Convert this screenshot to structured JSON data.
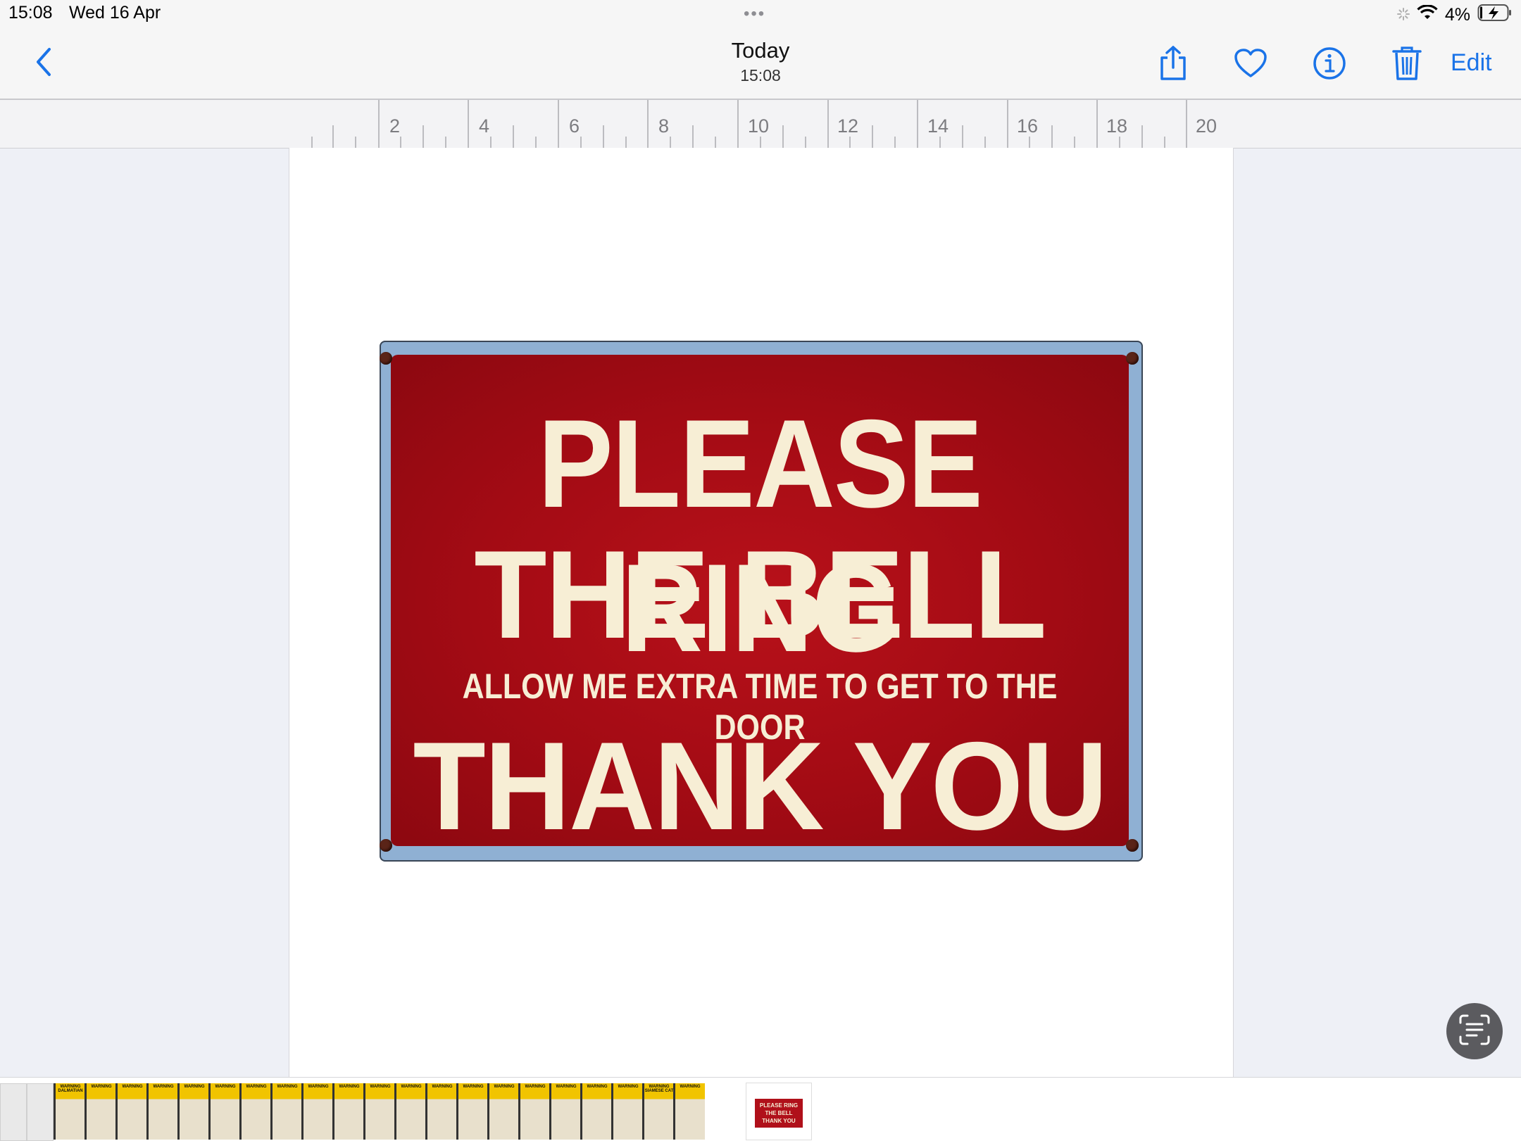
{
  "status_bar": {
    "time": "15:08",
    "date": "Wed 16 Apr",
    "battery": "4%",
    "more_indicator": "•••",
    "icons": [
      "activity-spinner-icon",
      "wifi-icon",
      "battery-charging-icon"
    ]
  },
  "nav": {
    "title": "Today",
    "subtitle": "15:08",
    "edit_label": "Edit",
    "accent": "#1a73e8",
    "icons": [
      "back-chevron-icon",
      "share-icon",
      "favorite-heart-icon",
      "info-icon",
      "trash-icon"
    ]
  },
  "ruler": {
    "labels": [
      "2",
      "4",
      "6",
      "8",
      "10",
      "12",
      "14",
      "16",
      "18",
      "20"
    ]
  },
  "document": {
    "sign": {
      "line1": "PLEASE RING",
      "line2": "THE BELL",
      "line3": "ALLOW ME EXTRA TIME TO GET TO THE DOOR",
      "line4": "THANK YOU",
      "colors": {
        "background": "#a30b14",
        "text": "#f7eed5",
        "frame": "#8fb0d3"
      }
    }
  },
  "live_text_button": {
    "icon": "live-text-icon"
  },
  "filmstrip": {
    "thumbnails": [
      {
        "kind": "document",
        "label": ""
      },
      {
        "kind": "document",
        "label": ""
      },
      {
        "kind": "warning",
        "label": "WARNING DALMATIAN"
      },
      {
        "kind": "warning",
        "label": "WARNING"
      },
      {
        "kind": "warning",
        "label": "WARNING"
      },
      {
        "kind": "warning",
        "label": "WARNING"
      },
      {
        "kind": "warning",
        "label": "WARNING"
      },
      {
        "kind": "warning",
        "label": "WARNING"
      },
      {
        "kind": "warning",
        "label": "WARNING"
      },
      {
        "kind": "warning",
        "label": "WARNING"
      },
      {
        "kind": "warning",
        "label": "WARNING"
      },
      {
        "kind": "warning",
        "label": "WARNING"
      },
      {
        "kind": "warning",
        "label": "WARNING"
      },
      {
        "kind": "warning",
        "label": "WARNING"
      },
      {
        "kind": "warning",
        "label": "WARNING"
      },
      {
        "kind": "warning",
        "label": "WARNING"
      },
      {
        "kind": "warning",
        "label": "WARNING"
      },
      {
        "kind": "warning",
        "label": "WARNING"
      },
      {
        "kind": "warning",
        "label": "WARNING"
      },
      {
        "kind": "warning",
        "label": "WARNING"
      },
      {
        "kind": "warning",
        "label": "WARNING"
      },
      {
        "kind": "warning",
        "label": "WARNING SIAMESE CAT"
      },
      {
        "kind": "warning",
        "label": "WARNING"
      },
      {
        "kind": "sign",
        "label": "PLEASE RING THE BELL THANK YOU"
      }
    ]
  }
}
